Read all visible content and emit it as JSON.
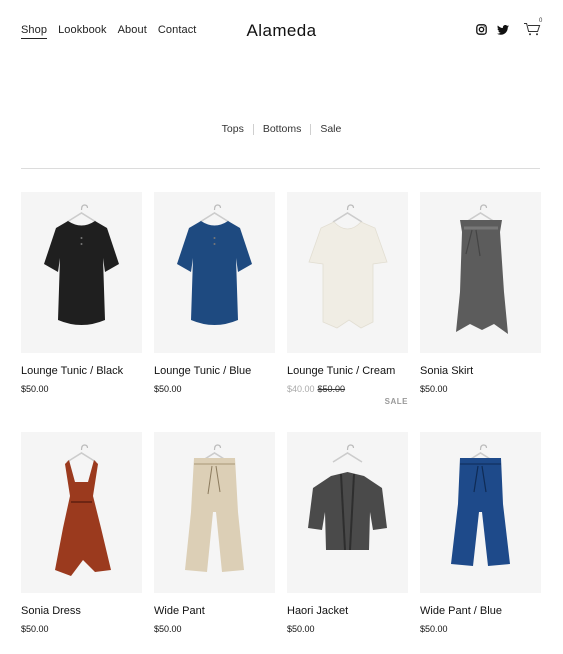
{
  "header": {
    "nav": [
      "Shop",
      "Lookbook",
      "About",
      "Contact"
    ],
    "brand": "Alameda",
    "cart_count": "0",
    "icons": [
      "instagram-icon",
      "twitter-icon",
      "cart-icon"
    ]
  },
  "categories": [
    "Tops",
    "Bottoms",
    "Sale"
  ],
  "products": [
    {
      "title": "Lounge Tunic / Black",
      "price": "$50.00",
      "color": "#1f1f1f",
      "kind": "tunic"
    },
    {
      "title": "Lounge Tunic / Blue",
      "price": "$50.00",
      "color": "#1e4a80",
      "kind": "tunic"
    },
    {
      "title": "Lounge Tunic / Cream",
      "sale_price": "$40.00",
      "original_price": "$50.00",
      "badge": "SALE",
      "color": "#f0ede4",
      "kind": "tunic-cream"
    },
    {
      "title": "Sonia Skirt",
      "price": "$50.00",
      "color": "#5c5c5c",
      "kind": "skirt"
    },
    {
      "title": "Sonia Dress",
      "price": "$50.00",
      "color": "#9b3a1e",
      "kind": "dress"
    },
    {
      "title": "Wide Pant",
      "price": "$50.00",
      "color": "#dccfb6",
      "kind": "pant"
    },
    {
      "title": "Haori Jacket",
      "price": "$50.00",
      "color": "#4a4a4a",
      "kind": "jacket"
    },
    {
      "title": "Wide Pant / Blue",
      "price": "$50.00",
      "color": "#1e4a8a",
      "kind": "pant-blue"
    }
  ]
}
